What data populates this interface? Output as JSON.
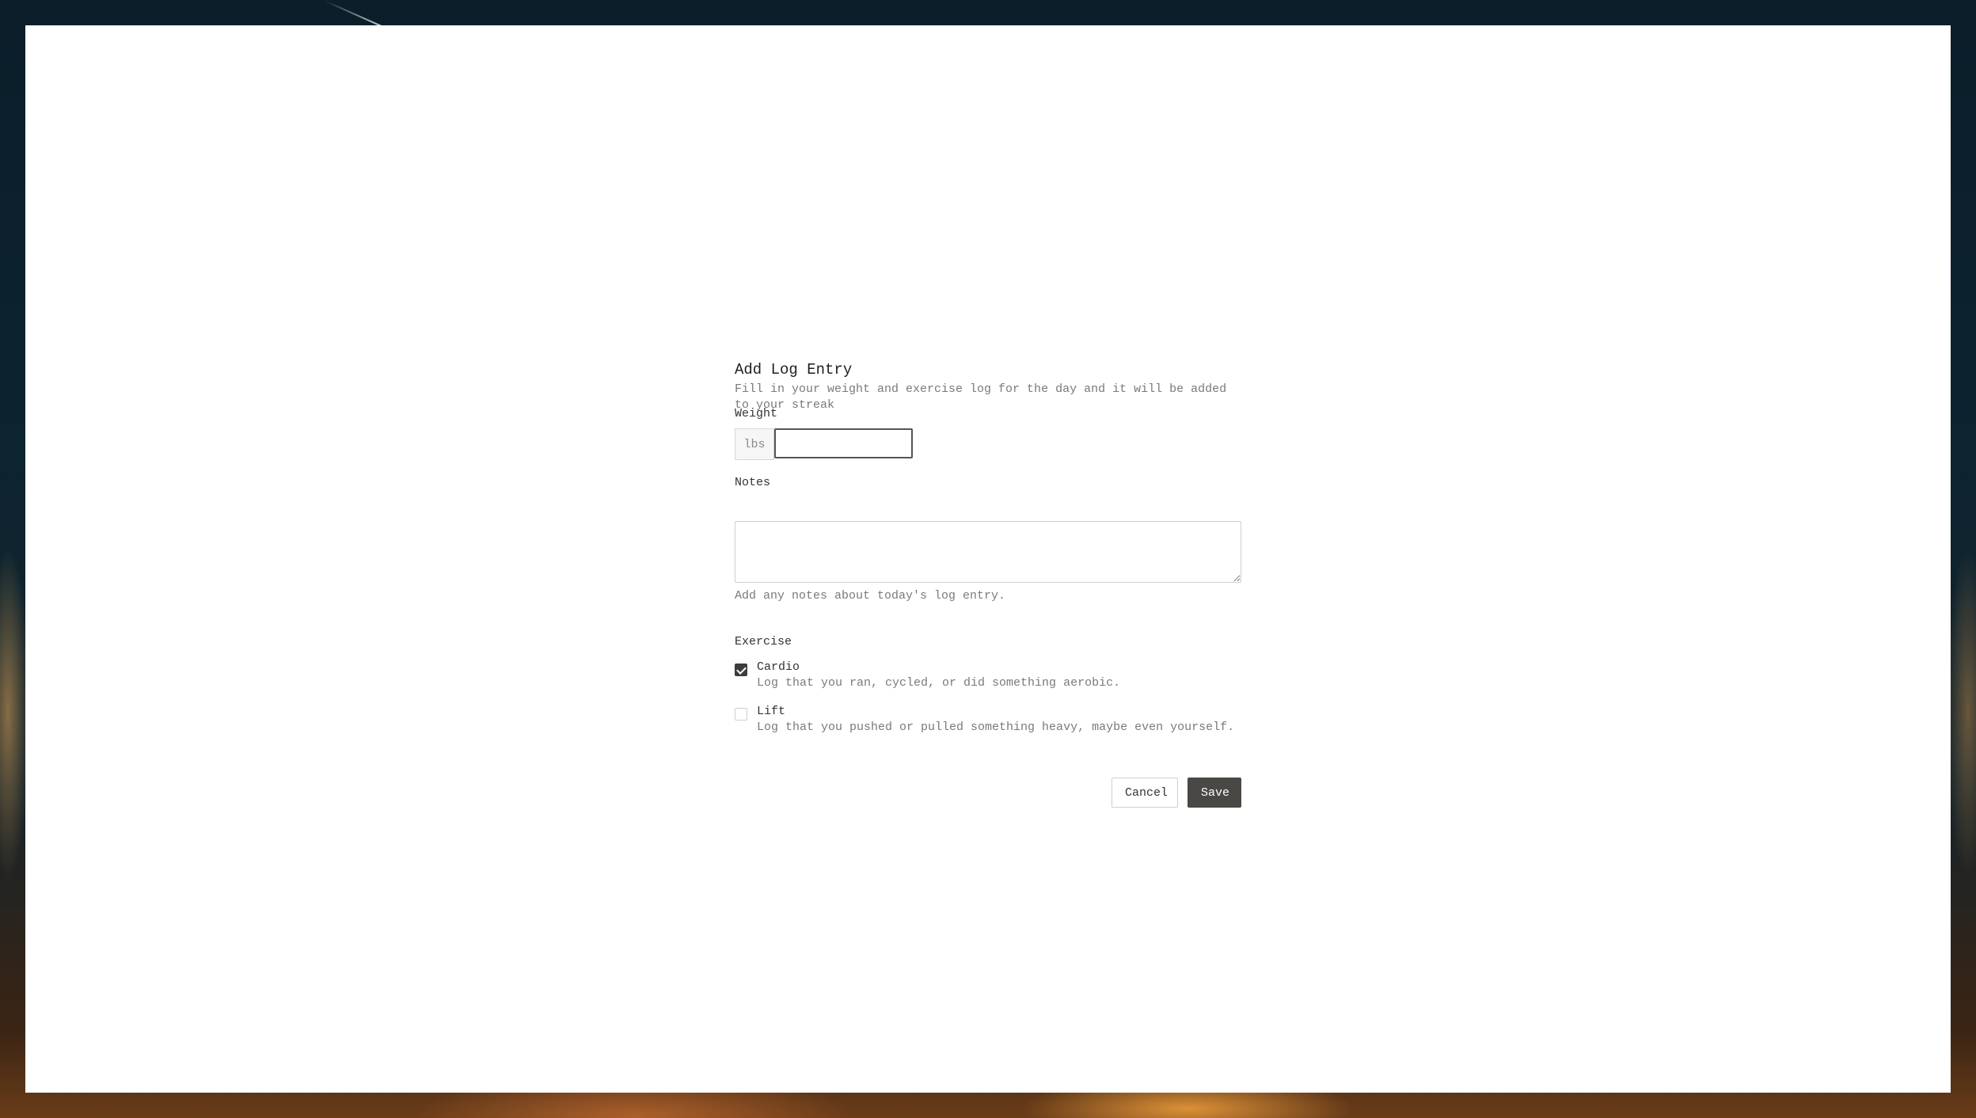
{
  "form": {
    "title": "Add Log Entry",
    "subtitle": "Fill in your weight and exercise log for the day and it will be added to your streak",
    "weight": {
      "label": "Weight",
      "unit": "lbs",
      "value": ""
    },
    "notes": {
      "label": "Notes",
      "value": "",
      "hint": "Add any notes about today's log entry."
    },
    "exercise": {
      "label": "Exercise",
      "options": [
        {
          "label": "Cardio",
          "description": "Log that you ran, cycled, or did something aerobic.",
          "checked": true
        },
        {
          "label": "Lift",
          "description": "Log that you pushed or pulled something heavy, maybe even yourself.",
          "checked": false
        }
      ]
    },
    "actions": {
      "cancel_label": "Cancel",
      "save_label": "Save"
    }
  },
  "colors": {
    "primary_button": "#4a4845",
    "checkbox_checked": "#3d3d3d",
    "muted_text": "#7a7a7a"
  }
}
